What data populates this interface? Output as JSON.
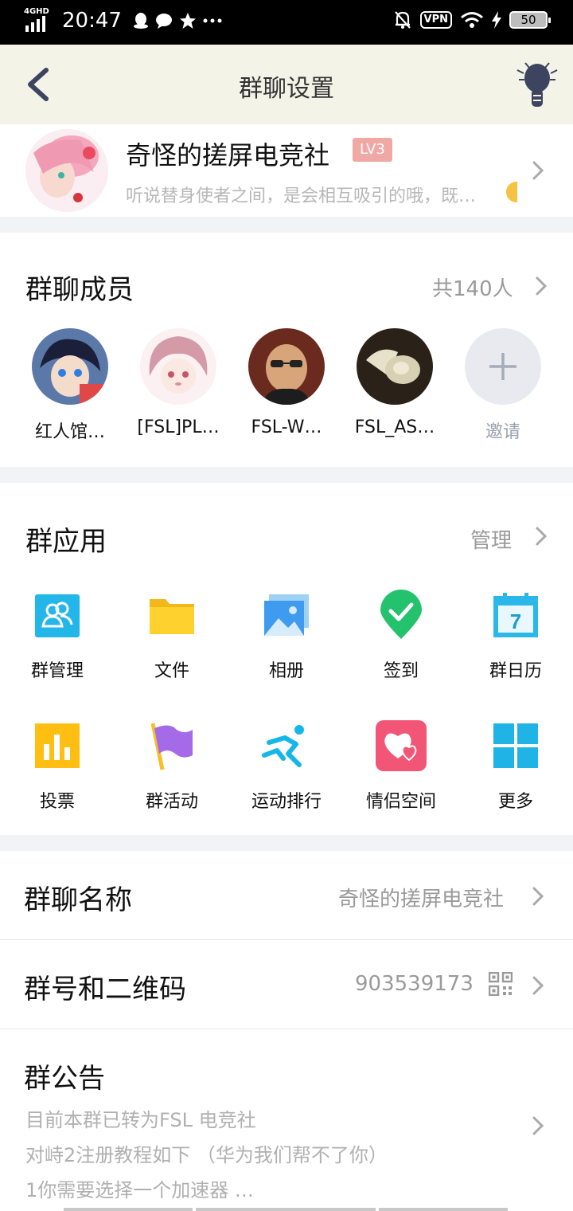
{
  "status_bar": {
    "network": "4GHD",
    "time": "20:47",
    "vpn": "VPN",
    "battery": "50",
    "icons": [
      "qq-penguin-icon",
      "chat-bubble-icon",
      "star-icon",
      "more-dots-icon",
      "bell-off-icon",
      "wifi-icon",
      "charging-icon"
    ]
  },
  "nav": {
    "title": "群聊设置",
    "back_icon": "back-chevron-icon",
    "right_icon": "lightbulb-icon"
  },
  "group": {
    "name": "奇怪的搓屏电竞社",
    "level": "LV3",
    "description": "听说替身使者之间，是会相互吸引的哦，既…"
  },
  "members": {
    "title": "群聊成员",
    "count": "共140人",
    "list": [
      {
        "name": "红人馆…"
      },
      {
        "name": "[FSL]PL…"
      },
      {
        "name": "FSL-W…"
      },
      {
        "name": "FSL_AS…"
      }
    ],
    "invite_label": "邀请"
  },
  "apps": {
    "title": "群应用",
    "manage": "管理",
    "items": [
      {
        "label": "群管理",
        "icon": "group-manage-icon"
      },
      {
        "label": "文件",
        "icon": "folder-icon"
      },
      {
        "label": "相册",
        "icon": "photo-album-icon"
      },
      {
        "label": "签到",
        "icon": "check-in-icon"
      },
      {
        "label": "群日历",
        "icon": "calendar-icon"
      },
      {
        "label": "投票",
        "icon": "vote-chart-icon"
      },
      {
        "label": "群活动",
        "icon": "flag-icon"
      },
      {
        "label": "运动排行",
        "icon": "running-icon"
      },
      {
        "label": "情侣空间",
        "icon": "hearts-icon"
      },
      {
        "label": "更多",
        "icon": "grid-more-icon"
      }
    ],
    "calendar_day": "7"
  },
  "settings": {
    "group_name": {
      "title": "群聊名称",
      "value": "奇怪的搓屏电竞社"
    },
    "group_id": {
      "title": "群号和二维码",
      "value": "903539173"
    },
    "notice": {
      "title": "群公告",
      "lines": [
        "目前本群已转为FSL 电竞社",
        "对峙2注册教程如下 （华为我们帮不了你）",
        "1你需要选择一个加速器 …"
      ]
    }
  },
  "colors": {
    "nav_bg": "#f4f3e7",
    "page_bg": "#f2f3f7",
    "level_badge": "#f1a8a5"
  }
}
